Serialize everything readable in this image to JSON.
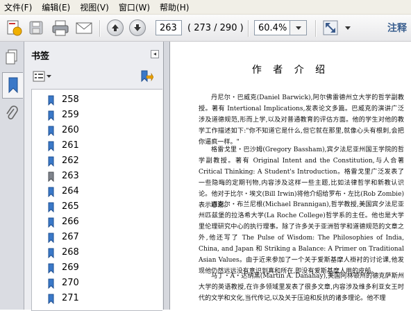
{
  "menu": [
    "文件(F)",
    "编辑(E)",
    "视图(V)",
    "窗口(W)",
    "帮助(H)"
  ],
  "toolbar": {
    "page_value": "263",
    "page_count": "( 273 / 290 )",
    "zoom_value": "60.4%",
    "annotate_label": "注释"
  },
  "bookmarks": {
    "title": "书签",
    "items": [
      "258",
      "259",
      "260",
      "261",
      "262",
      "263",
      "264",
      "265",
      "266",
      "267",
      "268",
      "269",
      "270",
      "271"
    ]
  },
  "document": {
    "heading": "作 者 介 绍",
    "paragraphs": [
      "丹尼尔・巴威克(Daniel Barwick),阿尔佛雷德州立大学的哲学副教授。著有 Intertional Implications,发表论文多篇。巴威克的演讲广泛涉及道德规范,形而上学,以及对普通教育的评估方面。他的学生对他的教学工作描述如下:\"你不知道它是什么,但它就在那里,就像心头有根刺,会把你逼疯一样。\"",
      "格雷戈里・巴沙姆(Gregory Bassham),宾夕法尼亚州国王学院的哲学副教授。著有 Original Intent and the Constitution,与人合著 Critical Thinking: A Student's Introduction。格雷戈里广泛发表了一些隐晦的定期刊物,内容涉及这样一些主题,比如法律哲学和新教认识论。他对于比尔・埃文(Bill Irwin)将他介绍给罗布・左比(Rob Zombie)表示感谢。",
      "迈克尔・布兰尼根(Michael Brannigan),哲学教授,美国宾夕法尼亚州匹兹堡的拉洛希大学(La Roche College)哲学系的主任。他也是大学里伦理研究中心的执行理事。除了许多关于亚洲哲学和道德规范的文章之外,他还写了 The Pulse of Wisdom: The Philosophies of India, China, and Japan 和 Striking a Balance: A Primer on Traditional Asian Values。由于近来参加了一个关于爱斯基摩人褂衬的讨论课,他发现他仍然远远没有意识到真和所在,即没有爱斯基摩人用的皮船。",
      "马丁・A・达纳黑(Martin A. Danahay),美国阿林顿州的德克萨斯州大学的英语教授,在许多领域里发表了很多文章,内容涉及维多利亚女王时代的文学和文化,当代传记,以及关于压迫和反抗的诸多理论。他不理"
    ]
  },
  "colors": {
    "menubar_bg": "#f1efe7",
    "panel_bg": "#ecedf1",
    "annotate_text": "#3a5f8f"
  }
}
